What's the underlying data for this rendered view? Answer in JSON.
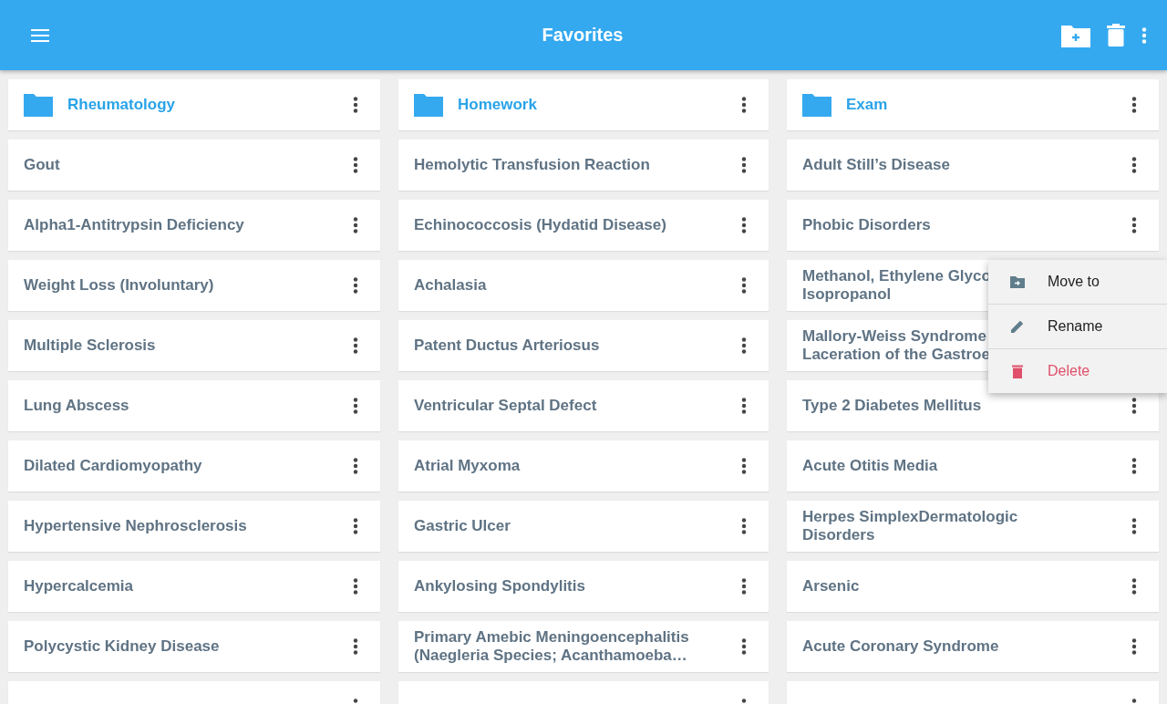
{
  "app_bar": {
    "title": "Favorites"
  },
  "columns": [
    {
      "folder": "Rheumatology",
      "items": [
        {
          "lines": [
            "Gout"
          ]
        },
        {
          "lines": [
            "Alpha1-Antitrypsin Deficiency"
          ]
        },
        {
          "lines": [
            "Weight Loss (Involuntary)"
          ]
        },
        {
          "lines": [
            "Multiple Sclerosis"
          ]
        },
        {
          "lines": [
            "Lung Abscess"
          ]
        },
        {
          "lines": [
            "Dilated Cardiomyopathy"
          ]
        },
        {
          "lines": [
            "Hypertensive Nephrosclerosis"
          ]
        },
        {
          "lines": [
            "Hypercalcemia"
          ]
        },
        {
          "lines": [
            "Polycystic Kidney Disease"
          ]
        }
      ]
    },
    {
      "folder": "Homework",
      "items": [
        {
          "lines": [
            "Hemolytic Transfusion Reaction"
          ]
        },
        {
          "lines": [
            "Echinococcosis (Hydatid Disease)"
          ]
        },
        {
          "lines": [
            "Achalasia"
          ]
        },
        {
          "lines": [
            "Patent Ductus Arteriosus"
          ]
        },
        {
          "lines": [
            "Ventricular Septal Defect"
          ]
        },
        {
          "lines": [
            "Atrial Myxoma"
          ]
        },
        {
          "lines": [
            "Gastric Ulcer"
          ]
        },
        {
          "lines": [
            "Ankylosing Spondylitis"
          ]
        },
        {
          "lines": [
            "Primary Amebic Meningoencephalitis",
            "(Naegleria Species; Acanthamoeba…"
          ]
        }
      ]
    },
    {
      "folder": "Exam",
      "items": [
        {
          "lines": [
            "Adult Still’s Disease"
          ]
        },
        {
          "lines": [
            "Phobic Disorders"
          ]
        },
        {
          "lines": [
            "Methanol, Ethylene Glyco",
            "Isopropanol"
          ]
        },
        {
          "lines": [
            "Mallory-Weiss Syndrome",
            "Laceration of the Gastroe"
          ]
        },
        {
          "lines": [
            "Type 2 Diabetes Mellitus"
          ]
        },
        {
          "lines": [
            "Acute Otitis Media"
          ]
        },
        {
          "lines": [
            "Herpes SimplexDermatologic",
            "Disorders"
          ]
        },
        {
          "lines": [
            "Arsenic"
          ]
        },
        {
          "lines": [
            "Acute Coronary Syndrome"
          ]
        }
      ]
    }
  ],
  "context_menu": [
    {
      "kind": "move",
      "label": "Move to"
    },
    {
      "kind": "rename",
      "label": "Rename"
    },
    {
      "kind": "delete",
      "label": "Delete"
    }
  ]
}
